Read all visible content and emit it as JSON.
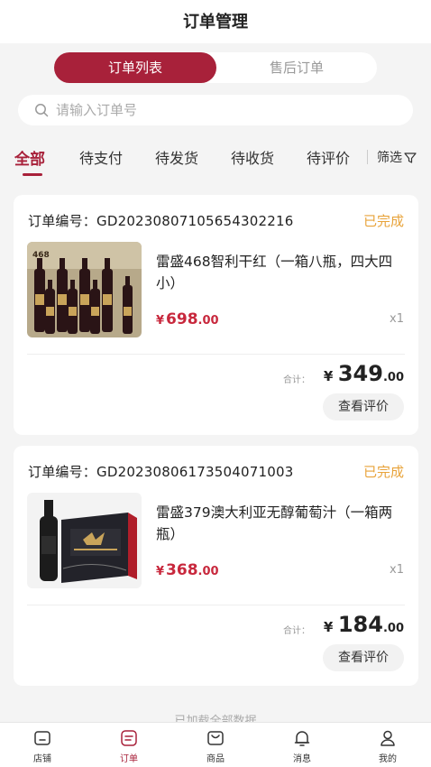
{
  "header": {
    "title": "订单管理"
  },
  "segment": {
    "active": "订单列表",
    "inactive": "售后订单"
  },
  "search": {
    "placeholder": "请输入订单号"
  },
  "tabs": [
    "全部",
    "待支付",
    "待发货",
    "待收货",
    "待评价"
  ],
  "filter": {
    "label": "筛选"
  },
  "orders": [
    {
      "order_label": "订单编号：GD20230807105654302216",
      "status": "已完成",
      "product_name": "雷盛468智利干红（一箱八瓶，四大四小）",
      "price_currency": "¥",
      "price_int": "698",
      "price_dec": ".00",
      "quantity": "x1",
      "total_label": "合计：",
      "total_currency": "¥",
      "total_int": "349",
      "total_dec": ".00",
      "action": "查看评价",
      "thumb_text": "468"
    },
    {
      "order_label": "订单编号：GD20230806173504071003",
      "status": "已完成",
      "product_name": "雷盛379澳大利亚无醇葡萄汁（一箱两瓶）",
      "price_currency": "¥",
      "price_int": "368",
      "price_dec": ".00",
      "quantity": "x1",
      "total_label": "合计：",
      "total_currency": "¥",
      "total_int": "184",
      "total_dec": ".00",
      "action": "查看评价"
    }
  ],
  "loaded_text": "已加载全部数据",
  "bottom_nav": [
    {
      "label": "店铺",
      "icon": "store-icon"
    },
    {
      "label": "订单",
      "icon": "order-icon"
    },
    {
      "label": "商品",
      "icon": "bag-icon"
    },
    {
      "label": "消息",
      "icon": "bell-icon"
    },
    {
      "label": "我的",
      "icon": "user-icon"
    }
  ],
  "colors": {
    "accent": "#a8213a",
    "status": "#e8a33a",
    "price": "#c8283d"
  }
}
